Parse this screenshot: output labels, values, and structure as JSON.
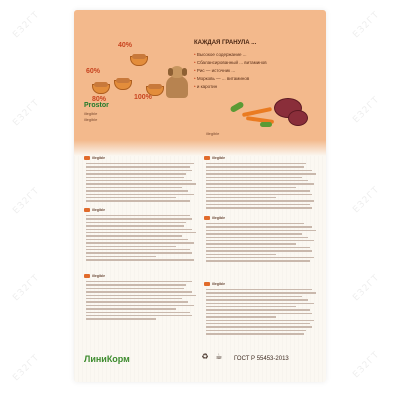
{
  "watermark": "ЕЗ2ГТ",
  "header": {
    "headline": "КАЖДАЯ ГРАНУЛА ...",
    "bullets": [
      "Высокое содержание ...",
      "Сбалансированный ... витаминов",
      "Рис — источник ...",
      "Морковь — ... витаминов",
      "и каротин"
    ],
    "ration_percentages": [
      "40%",
      "60%",
      "100%",
      "80%"
    ],
    "brand_subline": "Prostor",
    "brand_lines": [
      "illegible",
      "illegible"
    ],
    "weight_note": "illegible"
  },
  "body": {
    "section_titles": [
      "illegible",
      "illegible",
      "illegible",
      "illegible",
      "illegible",
      "illegible"
    ]
  },
  "footer": {
    "logo": "ЛиниКорм",
    "gost": "ГОСТ Р 55453-2013"
  },
  "colors": {
    "header_bg": "#f3b98c",
    "accent_orange": "#e16b2b",
    "logo_green": "#3c8b2d",
    "text_brown": "#5a2e18"
  }
}
